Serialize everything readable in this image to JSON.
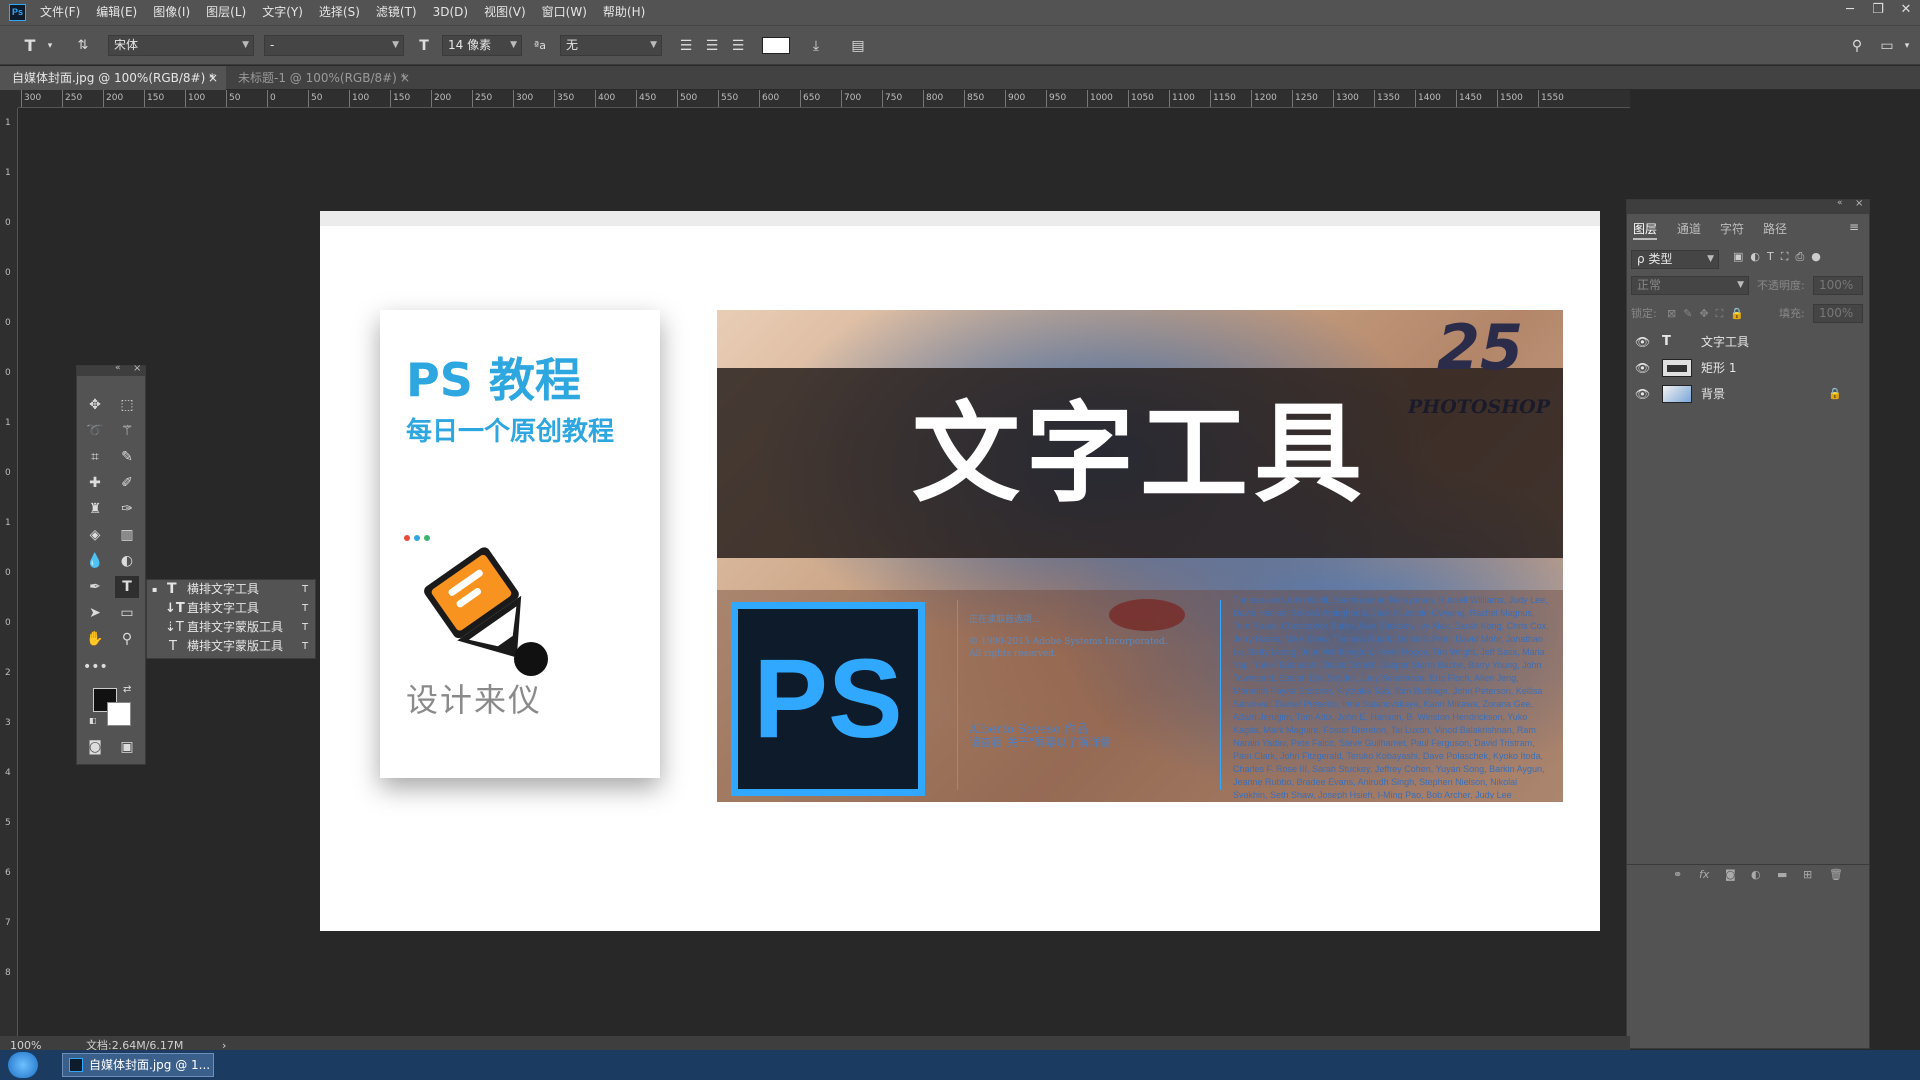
{
  "app": {
    "logo": "Ps"
  },
  "menu": [
    "文件(F)",
    "编辑(E)",
    "图像(I)",
    "图层(L)",
    "文字(Y)",
    "选择(S)",
    "滤镜(T)",
    "3D(D)",
    "视图(V)",
    "窗口(W)",
    "帮助(H)"
  ],
  "window_controls": {
    "minimize": "─",
    "restore": "❐",
    "close": "✕"
  },
  "options": {
    "tool_icon": "T",
    "font_family": "宋体",
    "font_style": "-",
    "size_icon": "T",
    "font_size": "14 像素",
    "aa_icon": "ªa",
    "antialias": "无"
  },
  "tabs": [
    {
      "label": "自媒体封面.jpg @ 100%(RGB/8#) *",
      "close": "×",
      "active": true
    },
    {
      "label": "未标题-1 @ 100%(RGB/8#) *",
      "close": "×",
      "active": false
    }
  ],
  "ruler": {
    "h": [
      "300",
      "250",
      "200",
      "150",
      "100",
      "50",
      "0",
      "50",
      "100",
      "150",
      "200",
      "250",
      "300",
      "350",
      "400",
      "450",
      "500",
      "550",
      "600",
      "650",
      "700",
      "750",
      "800",
      "850",
      "900",
      "950",
      "1000",
      "1050",
      "1100",
      "1150",
      "1200",
      "1250",
      "1300",
      "1350",
      "1400",
      "1450",
      "1500",
      "1550"
    ],
    "v": [
      "1",
      "1",
      "0",
      "0",
      "0",
      "0",
      "1",
      "0",
      "1",
      "0",
      "0",
      "2",
      "3",
      "4",
      "5",
      "6",
      "7",
      "8"
    ]
  },
  "card": {
    "title": "PS 教程",
    "subtitle": "每日一个原创教程",
    "brand": "设计来仪"
  },
  "banner": {
    "headline": "文字工具",
    "badge_number": "25",
    "badge_text": "PHOTOSHOP",
    "ps_logo": "PS",
    "mid_text_1": "正在读取首选项...",
    "mid_text_2": "© 1990-2015 Adobe Systems Incorporated.",
    "mid_text_3": "All rights reserved.",
    "artist": "Alberto Seveso 作品",
    "artist_note": "请查看\"关于\"屏幕以了解详情",
    "credits": "Thomas and John Knoll, Seetharaman Narayanan, Russell Williams, Judy Lee, David Hackel, Sohrab Amirghodsi, Jackie Lincoln-Owyang, Rachel Magnus, Tom Ruark, Christopher Butler, Alan Erickson, Ivy Mak, Sarah Kong, Chris Cox, Jerry Harris, Mike Shaw, Thomas Ruark, Dominic Petri, David Mohr, Jonathan Lo, Betty Leong, John Worthington, Kevin Hopps, Tim Wright, Jeff Sass, Maria Yap, Yukie Takahashi, David Dobish, Jasper Storm Bache, Barry Young, John Townsend, Steven Eric Snyder, Judy Severance, Eric Floch, Allen Jeng, Meredith Payne Stotzner, Kiyotaka Taki, Tom Burbage, John Peterson, Kellisa Sandoval, Daniel Presedo, Irina Satanovskaya, Kaori Mikawa, Zorana Gee, Adam Jerugim, Tom Attix, John E. Hanson, B. Winston Hendrickson, Yuko Kagita, Mark Maguire, Foster Brereton, Tai Luxon, Vinod Balakrishnan, Ram Narain Yadav, Pete Falco, Steve Guilhamet, Paul Ferguson, David Tristram, Pam Clark, John Fitzgerald, Teruko Kobayashi, Dave Polaschek, Kyoko Itoda, Charles F. Rose III, Sarah Stuckey, Jeffrey Cohen, Yuyan Song, Barkin Aygun, Jeanne Rubbo, Bradee Evans, Anirudh Singh, Stephen Nielson, Nikolai Svakhin, Seth Shaw, Joseph Hsieh, I-Ming Pao, Bob Archer, Judy Lee"
  },
  "flyout": [
    {
      "label": "横排文字工具",
      "key": "T",
      "active": true
    },
    {
      "label": "直排文字工具",
      "key": "T",
      "active": false
    },
    {
      "label": "直排文字蒙版工具",
      "key": "T",
      "active": false
    },
    {
      "label": "横排文字蒙版工具",
      "key": "T",
      "active": false
    }
  ],
  "panel": {
    "tabs": [
      "图层",
      "通道",
      "字符",
      "路径"
    ],
    "filter_label": "ρ 类型",
    "blend_mode": "正常",
    "opacity_label": "不透明度:",
    "opacity_value": "100%",
    "lock_label": "锁定:",
    "fill_label": "填充:",
    "fill_value": "100%",
    "layers": [
      {
        "name": "文字工具",
        "kind": "text"
      },
      {
        "name": "矩形 1",
        "kind": "shape"
      },
      {
        "name": "背景",
        "kind": "image",
        "locked": true
      }
    ]
  },
  "status": {
    "zoom": "100%",
    "doc": "文档:2.64M/6.17M",
    "arrow": "›"
  },
  "taskbar": {
    "item": "自媒体封面.jpg @ 1..."
  },
  "colors": {
    "ui_dark": "#535353",
    "canvas_bg": "#282828",
    "accent_blue": "#31a8ff",
    "ps_dark": "#0d1b2a",
    "orange": "#f7931e",
    "card_blue": "#2ea7e0"
  }
}
